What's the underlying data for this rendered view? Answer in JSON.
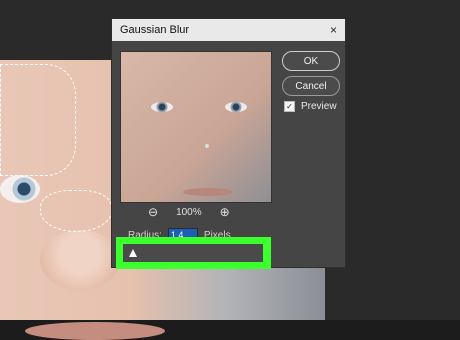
{
  "dialog": {
    "title": "Gaussian Blur",
    "close_glyph": "×",
    "ok_label": "OK",
    "cancel_label": "Cancel",
    "preview_label": "Preview",
    "preview_checked": true,
    "zoom_out_glyph": "⊖",
    "zoom_in_glyph": "⊕",
    "zoom_level": "100%",
    "radius_label": "Radius:",
    "radius_value": "1.4",
    "radius_unit": "Pixels",
    "slider_position_fraction": 0.07
  },
  "colors": {
    "highlight": "#3cff2e",
    "dialog_bg": "#454545",
    "titlebar_bg": "#e9e9e9",
    "radius_field_bg": "#1c5fb8"
  },
  "icons": [
    "close-icon",
    "zoom-out-icon",
    "zoom-in-icon",
    "checkbox-checked-icon",
    "slider-thumb-icon"
  ]
}
